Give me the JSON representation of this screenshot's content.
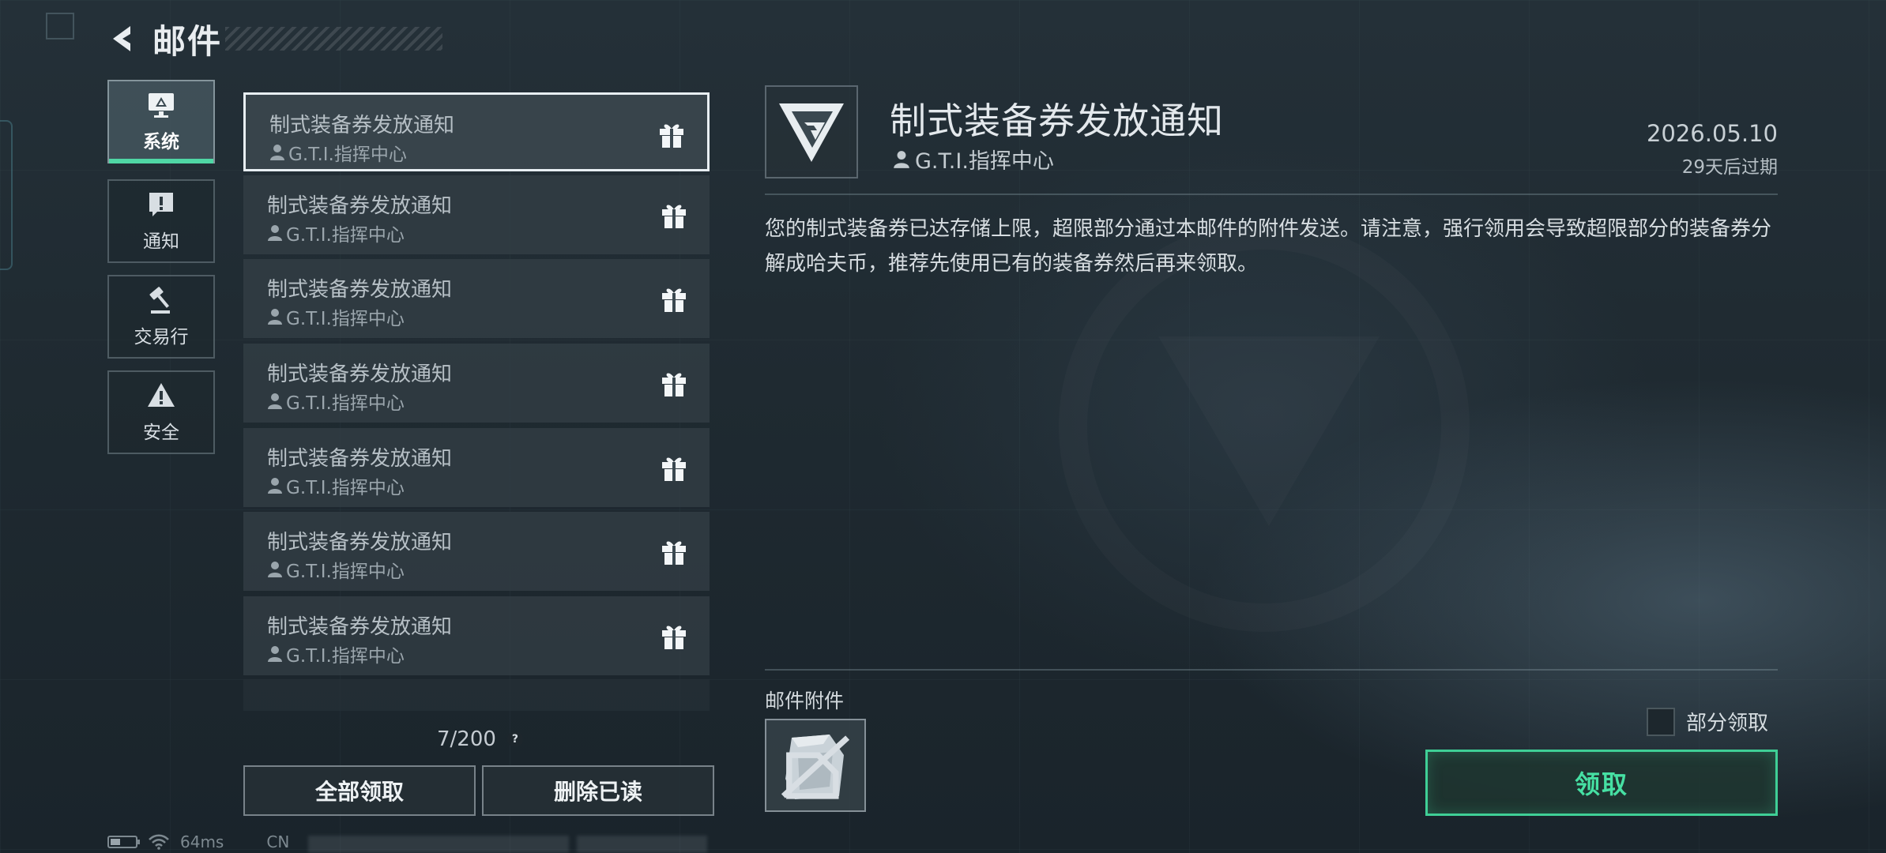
{
  "header": {
    "title": "邮件"
  },
  "categories": [
    {
      "label": "系统",
      "icon": "monitor-icon",
      "active": true
    },
    {
      "label": "通知",
      "icon": "alert-bubble-icon"
    },
    {
      "label": "交易行",
      "icon": "gavel-icon"
    },
    {
      "label": "安全",
      "icon": "warning-triangle-icon"
    }
  ],
  "mails": [
    {
      "title": "制式装备券发放通知",
      "sender": "G.T.I.指挥中心"
    },
    {
      "title": "制式装备券发放通知",
      "sender": "G.T.I.指挥中心"
    },
    {
      "title": "制式装备券发放通知",
      "sender": "G.T.I.指挥中心"
    },
    {
      "title": "制式装备券发放通知",
      "sender": "G.T.I.指挥中心"
    },
    {
      "title": "制式装备券发放通知",
      "sender": "G.T.I.指挥中心"
    },
    {
      "title": "制式装备券发放通知",
      "sender": "G.T.I.指挥中心"
    },
    {
      "title": "制式装备券发放通知",
      "sender": "G.T.I.指挥中心"
    }
  ],
  "list_footer": {
    "count": "7/200",
    "help": "?"
  },
  "buttons": {
    "claim_all": "全部领取",
    "delete_read": "删除已读"
  },
  "status_bar": {
    "ping": "64ms",
    "region": "CN"
  },
  "detail": {
    "title": "制式装备券发放通知",
    "sender": "G.T.I.指挥中心",
    "date": "2026.05.10",
    "expire": "29天后过期",
    "body": "您的制式装备券已达存储上限，超限部分通过本邮件的附件发送。请注意，强行领用会导致超限部分的装备券分解成哈夫币，推荐先使用已有的装备券然后再来领取。",
    "attachments_label": "邮件附件",
    "partial_claim_label": "部分领取",
    "claim_label": "领取"
  },
  "colors": {
    "accent": "#3fcf96",
    "active_tab_underline": "#4fd6a5"
  }
}
